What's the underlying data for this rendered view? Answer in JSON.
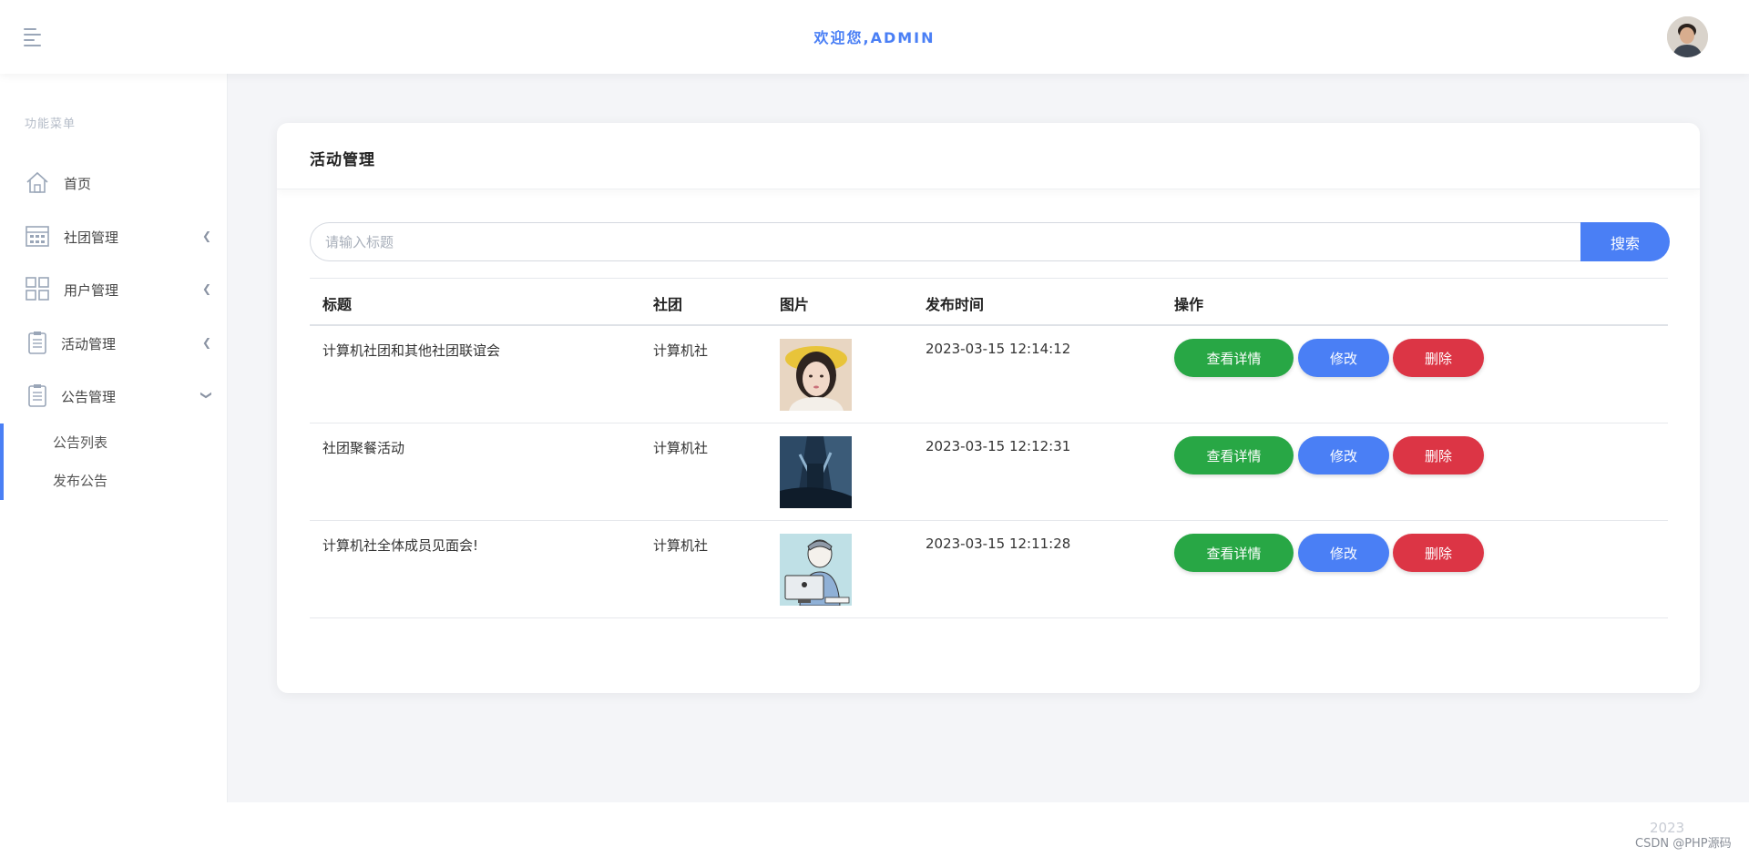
{
  "header": {
    "welcome": "欢迎您,ADMIN"
  },
  "sidebar": {
    "heading": "功能菜单",
    "items": [
      {
        "label": "首页",
        "icon": "home-icon"
      },
      {
        "label": "社团管理",
        "icon": "calendar-icon",
        "expandable": true
      },
      {
        "label": "用户管理",
        "icon": "grid-icon",
        "expandable": true
      },
      {
        "label": "活动管理",
        "icon": "clipboard-icon",
        "expandable": true
      },
      {
        "label": "公告管理",
        "icon": "clipboard-icon",
        "expandable": true,
        "expanded": true
      }
    ],
    "subitems": [
      {
        "label": "公告列表"
      },
      {
        "label": "发布公告"
      }
    ]
  },
  "card": {
    "title": "活动管理"
  },
  "search": {
    "placeholder": "请输入标题",
    "value": "",
    "button_label": "搜索"
  },
  "table": {
    "columns": [
      "标题",
      "社团",
      "图片",
      "发布时间",
      "操作"
    ],
    "rows": [
      {
        "title": "计算机社团和其他社团联谊会",
        "club": "计算机社",
        "image": "portrait-photo",
        "time": "2023-03-15 12:14:12"
      },
      {
        "title": "社团聚餐活动",
        "club": "计算机社",
        "image": "dark-blue-art",
        "time": "2023-03-15 12:12:31"
      },
      {
        "title": "计算机社全体成员见面会!",
        "club": "计算机社",
        "image": "cartoon-computer-user",
        "time": "2023-03-15 12:11:28"
      }
    ],
    "actions": {
      "view": "查看详情",
      "edit": "修改",
      "delete": "删除"
    }
  },
  "footer": {
    "year": "2023",
    "watermark": "CSDN @PHP源码"
  },
  "colors": {
    "accent": "#4a7ff5",
    "view": "#28a745",
    "delete": "#dc3545"
  }
}
